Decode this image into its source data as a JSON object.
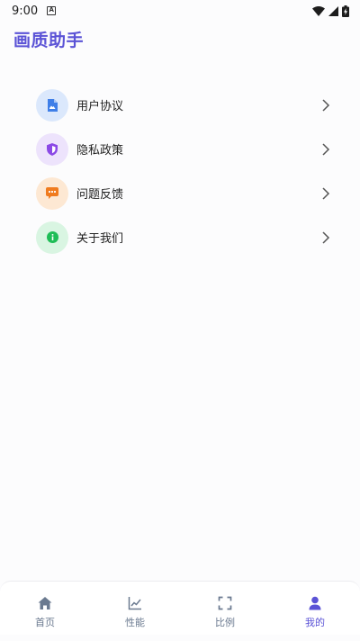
{
  "status_bar": {
    "time": "9:00",
    "app_indicator": "A"
  },
  "header": {
    "title": "画质助手"
  },
  "colors": {
    "accent": "#5b53d6",
    "blue_bg": "#dbe8fc",
    "blue_fg": "#3f7fe8",
    "purple_bg": "#ede3fc",
    "purple_fg": "#8b49e6",
    "orange_bg": "#fde8d3",
    "orange_fg": "#f07b1e",
    "green_bg": "#d9f5e2",
    "green_fg": "#1fbd57"
  },
  "menu": {
    "items": [
      {
        "label": "用户协议",
        "icon": "document-icon"
      },
      {
        "label": "隐私政策",
        "icon": "shield-icon"
      },
      {
        "label": "问题反馈",
        "icon": "chat-bubble-icon"
      },
      {
        "label": "关于我们",
        "icon": "info-icon"
      }
    ]
  },
  "bottom_nav": {
    "tabs": [
      {
        "label": "首页",
        "icon": "home-icon"
      },
      {
        "label": "性能",
        "icon": "line-chart-icon"
      },
      {
        "label": "比例",
        "icon": "fullscreen-icon"
      },
      {
        "label": "我的",
        "icon": "user-icon",
        "active": true
      }
    ]
  }
}
